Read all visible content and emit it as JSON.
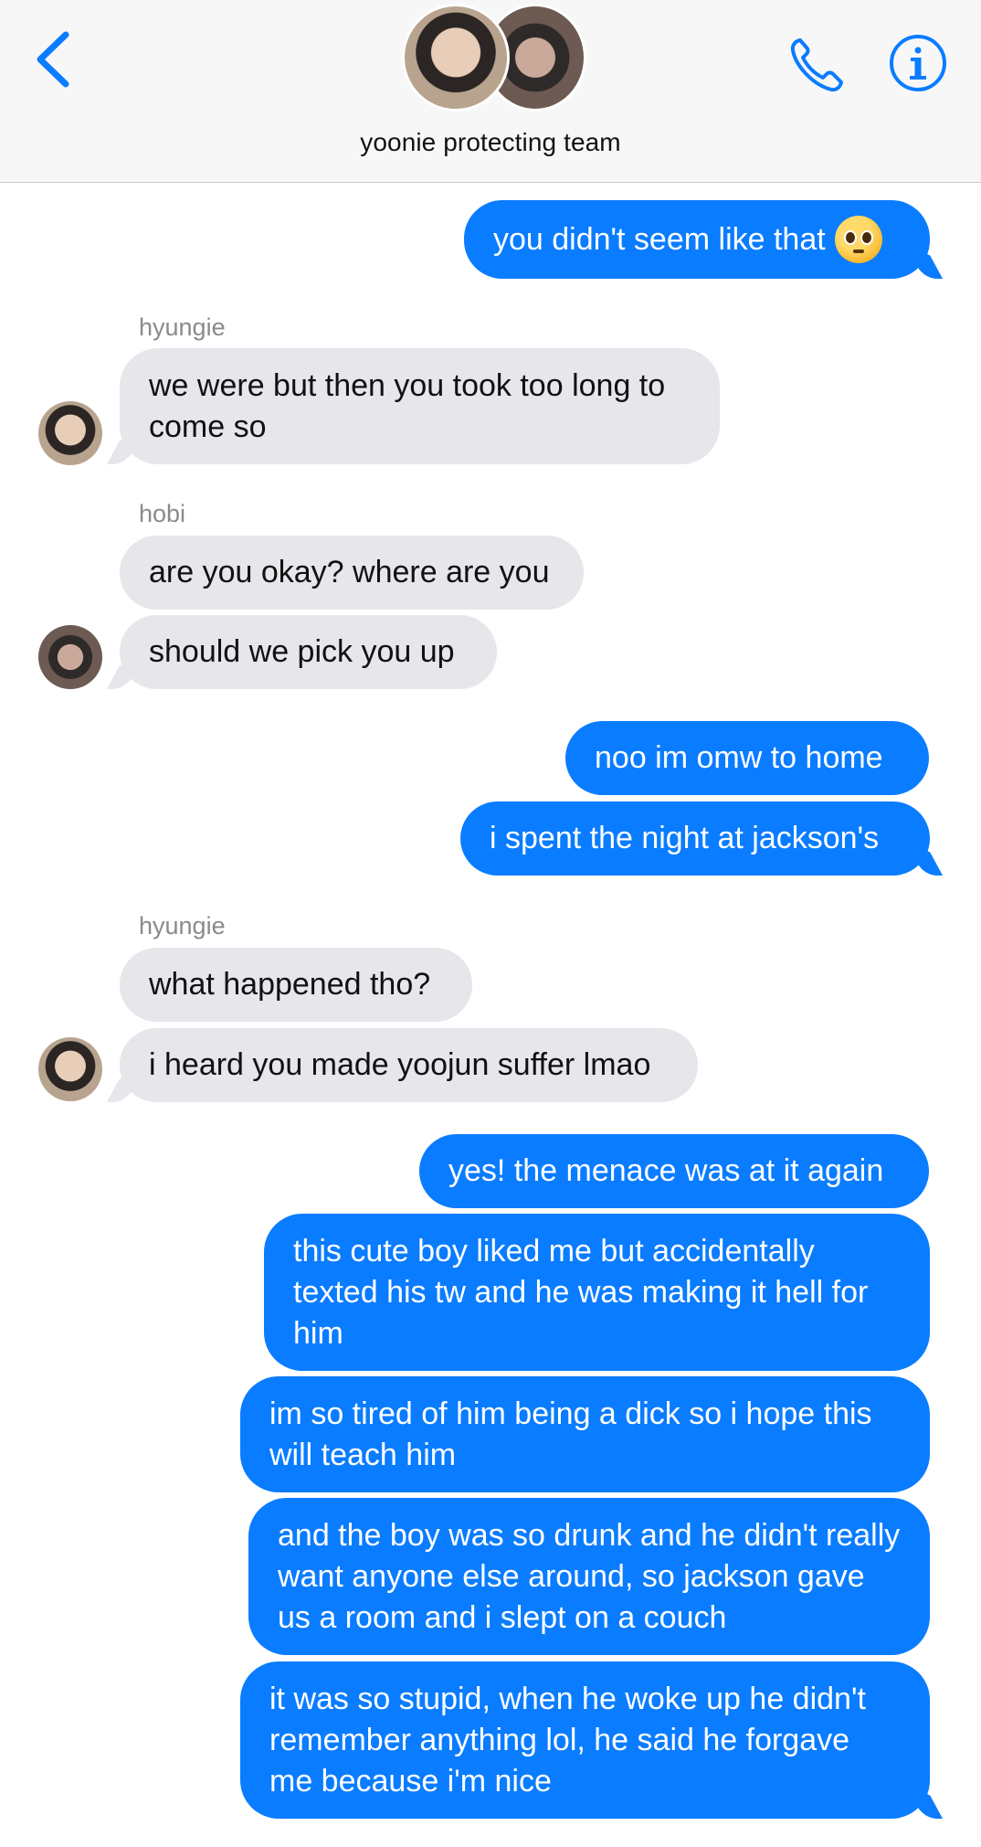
{
  "header": {
    "group_name": "yoonie protecting team",
    "back_label": "<",
    "call_icon": "phone-icon",
    "info_icon": "info-icon"
  },
  "messages": [
    {
      "dir": "out",
      "text": "you didn't seem like that",
      "emoji": "pleading-face"
    },
    {
      "dir": "in",
      "sender": "hyungie",
      "text": "we were but then you took too long to come so"
    },
    {
      "dir": "in",
      "sender": "hobi",
      "text": "are you okay? where are you"
    },
    {
      "dir": "in",
      "text": "should we pick you up"
    },
    {
      "dir": "out",
      "text": "noo im omw to home"
    },
    {
      "dir": "out",
      "text": "i spent the night at jackson's"
    },
    {
      "dir": "in",
      "sender": "hyungie",
      "text": "what happened tho?"
    },
    {
      "dir": "in",
      "text": "i heard you made yoojun suffer lmao"
    },
    {
      "dir": "out",
      "text": "yes! the menace was at it again"
    },
    {
      "dir": "out",
      "text": "this cute boy liked me but accidentally texted his tw and he was making it hell for him"
    },
    {
      "dir": "out",
      "text": "im so tired of him being a dick so i hope this will teach him"
    },
    {
      "dir": "out",
      "text": "and the boy was so drunk and he didn't really want anyone else around, so jackson gave us a room and i slept on a couch"
    },
    {
      "dir": "out",
      "text": "it was so stupid, when he woke up he didn't remember anything lol, he said he forgave me because i'm nice"
    }
  ],
  "colors": {
    "outgoing_bubble": "#0a7cff",
    "incoming_bubble": "#e6e6eb",
    "accent": "#0a7cff"
  }
}
